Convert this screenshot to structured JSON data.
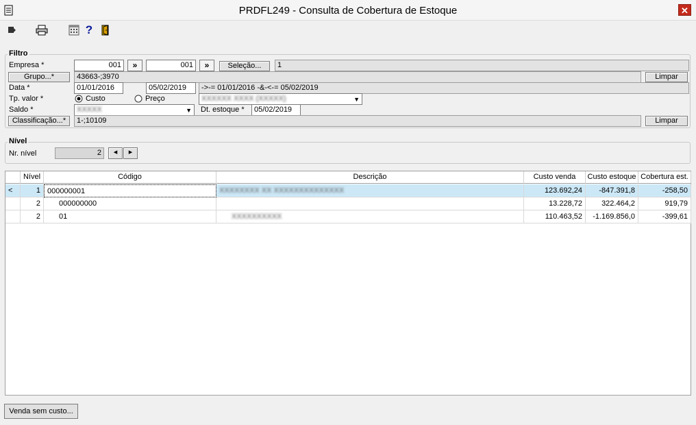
{
  "window": {
    "title": "PRDFL249 - Consulta de Cobertura de Estoque",
    "close_glyph": "✕"
  },
  "toolbar": {
    "icons": [
      "exit-icon",
      "print-icon",
      "calculator-icon",
      "help-icon",
      "door-icon"
    ],
    "help_glyph": "?"
  },
  "filtro": {
    "label": "Filtro",
    "empresa_label": "Empresa *",
    "empresa_from": "001",
    "empresa_to": "001",
    "arrow_label": "»",
    "selecao_button": "Seleção...",
    "selecao_value": "1",
    "grupo_button": "Grupo...*",
    "grupo_value": "43663-;3970",
    "limpar_label": "Limpar",
    "data_label": "Data *",
    "data_from": "01/01/2016",
    "data_to": "05/02/2019",
    "data_range": "->-= 01/01/2016 -&-<-= 05/02/2019",
    "tpvalor_label": "Tp. valor *",
    "custo_label": "Custo",
    "preco_label": "Preço",
    "tabela_value": "XXXXXX XXXX (XXXXX)",
    "saldo_label": "Saldo *",
    "saldo_value": "XXXXX",
    "dt_estoque_label": "Dt. estoque *",
    "dt_estoque_value": "05/02/2019",
    "classificacao_button": "Classificação...*",
    "classificacao_value": "1-;10109"
  },
  "nivel": {
    "label": "Nível",
    "nr_nivel_label": "Nr. nível",
    "nr_nivel_value": "2",
    "left_glyph": "◂",
    "right_glyph": "▸"
  },
  "grid": {
    "headers": [
      "",
      "Nível",
      "Código",
      "Descrição",
      "Custo venda",
      "Custo estoque",
      "Cobertura est."
    ],
    "rows": [
      {
        "marker": "<",
        "nivel": "1",
        "codigo": "000000001",
        "descricao": "XXXXXXXX XX XXXXXXXXXXXXXX",
        "custo_venda": "123.692,24",
        "custo_estoque": "-847.391,8",
        "cobertura": "-258,50"
      },
      {
        "marker": "",
        "nivel": "2",
        "codigo": "000000000",
        "descricao": "",
        "custo_venda": "13.228,72",
        "custo_estoque": "322.464,2",
        "cobertura": "919,79"
      },
      {
        "marker": "",
        "nivel": "2",
        "codigo": "01",
        "descricao": "XXXXXXXXXX",
        "custo_venda": "110.463,52",
        "custo_estoque": "-1.169.856,0",
        "cobertura": "-399,61"
      }
    ]
  },
  "footer": {
    "venda_sem_custo_button": "Venda sem custo..."
  }
}
